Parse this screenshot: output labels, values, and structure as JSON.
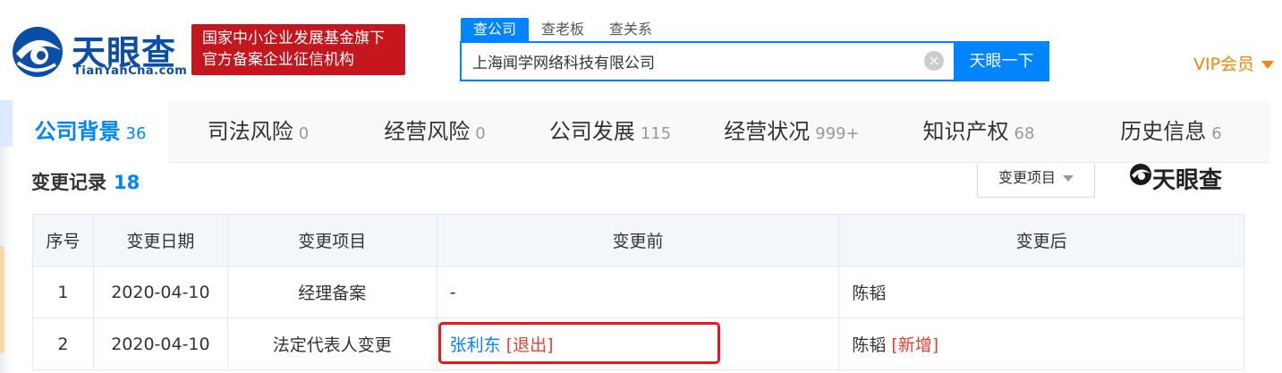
{
  "header": {
    "logo_cn": "天眼查",
    "logo_en": "TianYanCha.com",
    "gov_badge_line1": "国家中小企业发展基金旗下",
    "gov_badge_line2": "官方备案企业征信机构",
    "search_tabs": [
      {
        "label": "查公司",
        "active": true
      },
      {
        "label": "查老板",
        "active": false
      },
      {
        "label": "查关系",
        "active": false
      }
    ],
    "search_value": "上海闻学网络科技有限公司",
    "clear_glyph": "×",
    "search_button": "天眼一下",
    "vip_label": "VIP会员"
  },
  "nav": {
    "items": [
      {
        "label": "公司背景",
        "count": "36",
        "active": true
      },
      {
        "label": "司法风险",
        "count": "0",
        "active": false
      },
      {
        "label": "经营风险",
        "count": "0",
        "active": false
      },
      {
        "label": "公司发展",
        "count": "115",
        "active": false
      },
      {
        "label": "经营状况",
        "count": "999+",
        "active": false
      },
      {
        "label": "知识产权",
        "count": "68",
        "active": false
      },
      {
        "label": "历史信息",
        "count": "6",
        "active": false
      }
    ]
  },
  "section": {
    "title": "变更记录",
    "count": "18",
    "filter_label": "变更项目",
    "watermark": "天眼查"
  },
  "table": {
    "headers": [
      "序号",
      "变更日期",
      "变更项目",
      "变更前",
      "变更后"
    ],
    "rows": [
      {
        "index": "1",
        "date": "2020-04-10",
        "item": "经理备案",
        "before_name": "-",
        "before_tag": "",
        "after_name": "陈韬",
        "after_tag": ""
      },
      {
        "index": "2",
        "date": "2020-04-10",
        "item": "法定代表人变更",
        "before_name": "张利东",
        "before_tag": "[退出]",
        "after_name": "陈韬",
        "after_tag": "[新增]"
      }
    ]
  },
  "colors": {
    "accent": "#0084ff",
    "brand": "#0a4ea8",
    "badge_red": "#c4161c",
    "vip_orange": "#f4840a",
    "highlight_red": "#e8181c"
  }
}
